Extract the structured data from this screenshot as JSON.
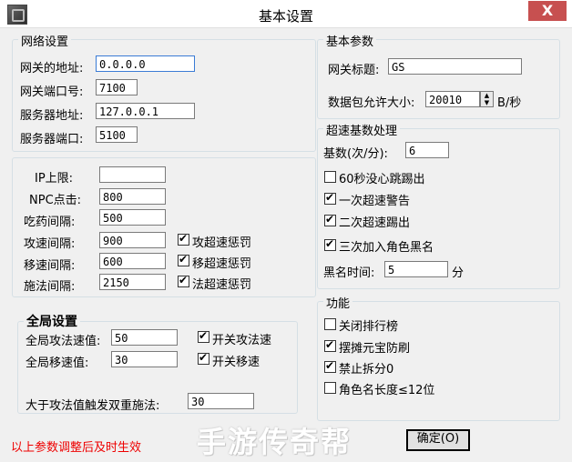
{
  "window": {
    "title": "基本设置",
    "close_label": "X"
  },
  "network": {
    "legend": "网络设置",
    "gateway_address_label": "网关的地址:",
    "gateway_address": "0.0.0.0",
    "gateway_port_label": "网关端口号:",
    "gateway_port": "7100",
    "server_address_label": "服务器地址:",
    "server_address": "127.0.0.1",
    "server_port_label": "服务器端口:",
    "server_port": "5100"
  },
  "limits": {
    "ip_limit_label": "IP上限:",
    "ip_limit": "",
    "npc_click_label": "NPC点击:",
    "npc_click": "800",
    "potion_interval_label": "吃药间隔:",
    "potion_interval": "500",
    "attack_interval_label": "攻速间隔:",
    "attack_interval": "900",
    "attack_penalty_label": "攻超速惩罚",
    "attack_penalty": true,
    "move_interval_label": "移速间隔:",
    "move_interval": "600",
    "move_penalty_label": "移超速惩罚",
    "move_penalty": true,
    "cast_interval_label": "施法间隔:",
    "cast_interval": "2150",
    "cast_penalty_label": "法超速惩罚",
    "cast_penalty": true
  },
  "global": {
    "legend": "全局设置",
    "attack_speed_label": "全局攻法速值:",
    "attack_speed": "50",
    "attack_toggle_label": "开关攻法速",
    "attack_toggle": true,
    "move_speed_label": "全局移速值:",
    "move_speed": "30",
    "move_toggle_label": "开关移速",
    "move_toggle": true,
    "double_trigger_label": "大于攻法值触发双重施法:",
    "double_trigger": "30"
  },
  "basic": {
    "legend": "基本参数",
    "gateway_title_label": "网关标题:",
    "gateway_title": "GS",
    "packet_size_label": "数据包允许大小:",
    "packet_size": "20010",
    "packet_unit": "B/秒"
  },
  "speedhack": {
    "legend": "超速基数处理",
    "base_label": "基数(次/分):",
    "base": "6",
    "no_heartbeat_label": "60秒没心跳踢出",
    "no_heartbeat": false,
    "first_warning_label": "一次超速警告",
    "first_warning": true,
    "second_kick_label": "二次超速踢出",
    "second_kick": true,
    "blacklist_label": "三次加入角色黑名",
    "blacklist": true,
    "blacklist_time_label": "黑名时间:",
    "blacklist_time": "5",
    "blacklist_unit": "分"
  },
  "features": {
    "legend": "功能",
    "close_ranking_label": "关闭排行榜",
    "close_ranking": false,
    "stall_protect_label": "摆摊元宝防刷",
    "stall_protect": true,
    "no_split_label": "禁止拆分0",
    "no_split": true,
    "name_length_label": "角色名长度≤12位",
    "name_length": false
  },
  "footer": {
    "notice": "以上参数调整后及时生效",
    "watermark": "手游传奇帮",
    "ok_label": "确定(O)"
  }
}
